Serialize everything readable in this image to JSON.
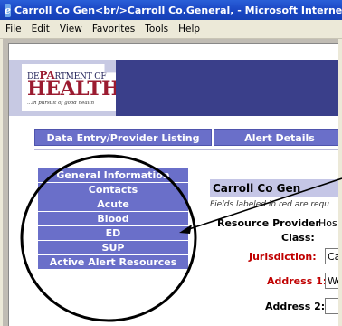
{
  "window": {
    "title": "Carroll Co Gen<br/>Carroll Co.General, - Microsoft Internet Explor"
  },
  "menubar": {
    "items": [
      "File",
      "Edit",
      "View",
      "Favorites",
      "Tools",
      "Help"
    ]
  },
  "logo": {
    "dept_prefix": "DE",
    "dept_big": "PA",
    "dept_suffix": "RTMENT OF",
    "health": "HEALTH",
    "tagline": "...in pursuit of good health"
  },
  "tabs": {
    "data_entry": "Data Entry/Provider Listing",
    "alert_details": "Alert Details"
  },
  "side_nav": {
    "items": [
      "General Information",
      "Contacts",
      "Acute",
      "Blood",
      "ED",
      "SUP",
      "Active Alert Resources"
    ]
  },
  "form": {
    "section_title": "Carroll Co Gen",
    "required_note": "Fields labeled in red are requ",
    "resource_provider_label": "Resource Provider",
    "resource_provider_value": "Hos",
    "class_label": "Class:",
    "jurisdiction_label": "Jurisdiction:",
    "jurisdiction_value": "Ca",
    "address1_label": "Address 1:",
    "address1_value": "We",
    "address2_label": "Address 2:",
    "address2_value": ""
  },
  "colors": {
    "nav_fill": "#6a6fc9",
    "header_dark": "#3a3f8a",
    "required_red": "#c00000",
    "annotation": "#000000"
  }
}
